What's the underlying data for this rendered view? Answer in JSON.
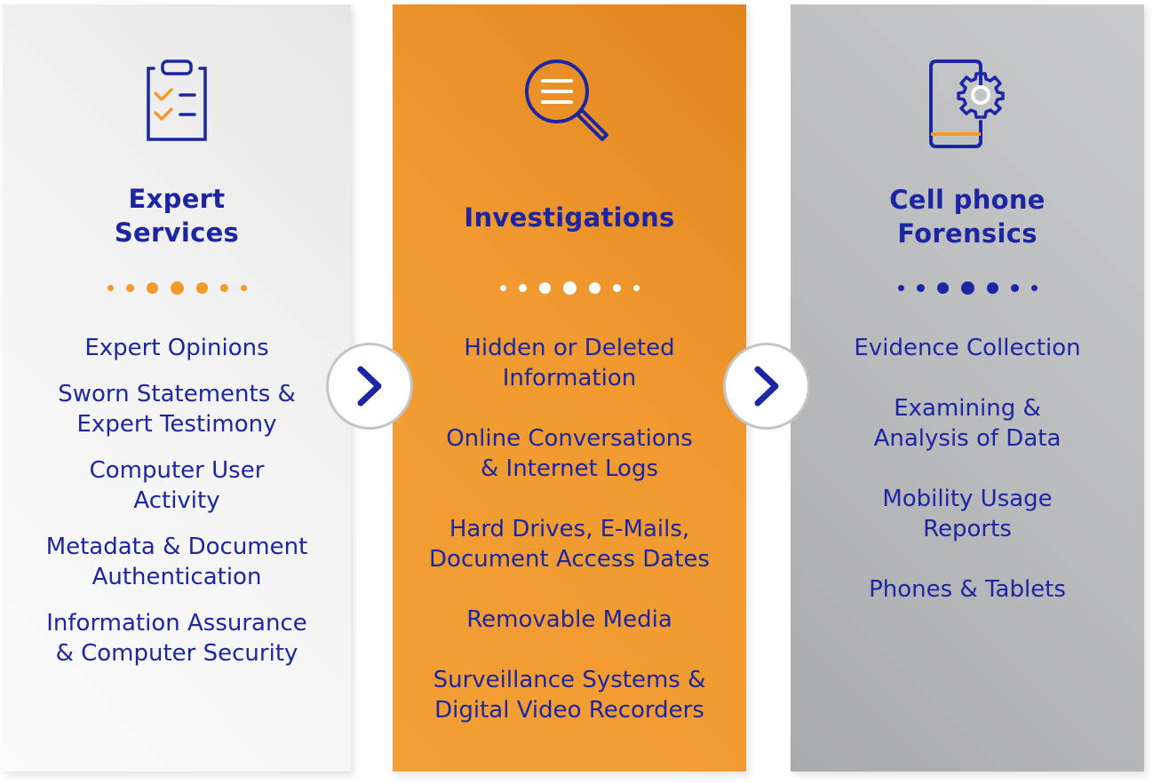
{
  "colors": {
    "accent_blue": "#1c26a3",
    "accent_orange": "#f39a2c",
    "panel_light": "#f2f2f2",
    "panel_orange": "#f09a30",
    "panel_gray": "#b8b9bb"
  },
  "columns": [
    {
      "icon": "clipboard-checklist-icon",
      "title_lines": [
        "Expert",
        "Services"
      ],
      "items": [
        "Expert Opinions",
        "Sworn Statements &\nExpert Testimony",
        "Computer User\nActivity",
        "Metadata & Document\nAuthentication",
        "Information Assurance\n& Computer Security"
      ]
    },
    {
      "icon": "magnifier-document-icon",
      "title_lines": [
        "Investigations"
      ],
      "items": [
        "Hidden or Deleted\nInformation",
        "Online Conversations\n& Internet Logs",
        "Hard Drives, E-Mails,\nDocument Access Dates",
        "Removable Media",
        "Surveillance Systems &\nDigital Video Recorders"
      ]
    },
    {
      "icon": "phone-gear-icon",
      "title_lines": [
        "Cell phone",
        "Forensics"
      ],
      "items": [
        "Evidence Collection",
        "Examining &\nAnalysis of Data",
        "Mobility Usage\nReports",
        "Phones & Tablets"
      ]
    }
  ],
  "arrows": [
    {
      "icon": "chevron-right-icon"
    },
    {
      "icon": "chevron-right-icon"
    }
  ]
}
